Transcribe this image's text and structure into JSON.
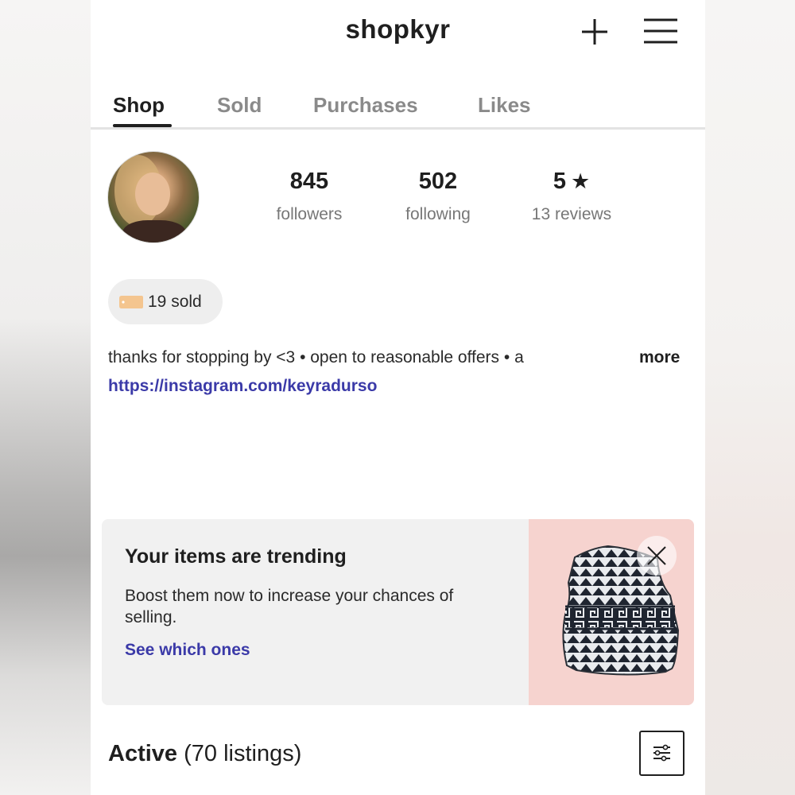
{
  "header": {
    "title": "shopkyr",
    "add_icon": "plus-icon",
    "menu_icon": "hamburger-menu-icon"
  },
  "tabs": [
    {
      "label": "Shop",
      "active": true
    },
    {
      "label": "Sold",
      "active": false
    },
    {
      "label": "Purchases",
      "active": false
    },
    {
      "label": "Likes",
      "active": false
    }
  ],
  "profile": {
    "followers": {
      "value": "845",
      "label": "followers"
    },
    "following": {
      "value": "502",
      "label": "following"
    },
    "rating": {
      "value": "5",
      "icon": "star-icon",
      "label": "13 reviews"
    },
    "sold_badge": {
      "label": "19 sold",
      "icon": "price-tag-icon"
    },
    "bio": "thanks for stopping by <3 • open to reasonable offers • a",
    "more_label": "more",
    "link": "https://instagram.com/keyradurso"
  },
  "trending_card": {
    "title": "Your items are trending",
    "subtitle": "Boost them now to increase your chances of selling.",
    "link_label": "See which ones",
    "image_icon": "crop-top-garment-image",
    "close_icon": "close-icon"
  },
  "listings": {
    "title": "Active",
    "count_label": "(70 listings)",
    "filter_icon": "filter-sliders-icon"
  },
  "colors": {
    "accent_link": "#3b3aa8",
    "text": "#1f1f1f",
    "muted": "#8a8a8a",
    "card_bg": "#f1f1f1",
    "image_bg": "#f6d3cf"
  }
}
